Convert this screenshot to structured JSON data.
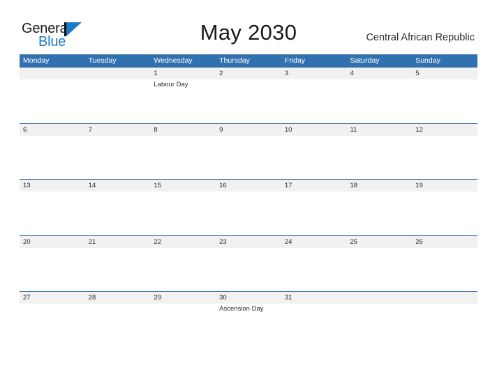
{
  "brand": {
    "logo_primary": "General",
    "logo_secondary": "Blue",
    "logo_mark": "blue-triangle-flag-icon",
    "primary_color": "#1b79c8"
  },
  "header": {
    "title": "May 2030",
    "country": "Central African Republic"
  },
  "theme": {
    "header_blue": "#3271b0",
    "band_gray": "#f1f1f1",
    "row_border": "#2f6ca8",
    "text_dark": "#262626"
  },
  "calendar": {
    "month": "May",
    "year": "2030",
    "week_start": "Monday",
    "weekdays": [
      "Monday",
      "Tuesday",
      "Wednesday",
      "Thursday",
      "Friday",
      "Saturday",
      "Sunday"
    ],
    "weeks": [
      {
        "days": [
          {
            "date": "",
            "events": []
          },
          {
            "date": "",
            "events": []
          },
          {
            "date": "1",
            "events": [
              "Labour Day"
            ]
          },
          {
            "date": "2",
            "events": []
          },
          {
            "date": "3",
            "events": []
          },
          {
            "date": "4",
            "events": []
          },
          {
            "date": "5",
            "events": []
          }
        ]
      },
      {
        "days": [
          {
            "date": "6",
            "events": []
          },
          {
            "date": "7",
            "events": []
          },
          {
            "date": "8",
            "events": []
          },
          {
            "date": "9",
            "events": []
          },
          {
            "date": "10",
            "events": []
          },
          {
            "date": "11",
            "events": []
          },
          {
            "date": "12",
            "events": []
          }
        ]
      },
      {
        "days": [
          {
            "date": "13",
            "events": []
          },
          {
            "date": "14",
            "events": []
          },
          {
            "date": "15",
            "events": []
          },
          {
            "date": "16",
            "events": []
          },
          {
            "date": "17",
            "events": []
          },
          {
            "date": "18",
            "events": []
          },
          {
            "date": "19",
            "events": []
          }
        ]
      },
      {
        "days": [
          {
            "date": "20",
            "events": []
          },
          {
            "date": "21",
            "events": []
          },
          {
            "date": "22",
            "events": []
          },
          {
            "date": "23",
            "events": []
          },
          {
            "date": "24",
            "events": []
          },
          {
            "date": "25",
            "events": []
          },
          {
            "date": "26",
            "events": []
          }
        ]
      },
      {
        "days": [
          {
            "date": "27",
            "events": []
          },
          {
            "date": "28",
            "events": []
          },
          {
            "date": "29",
            "events": []
          },
          {
            "date": "30",
            "events": [
              "Ascension Day"
            ]
          },
          {
            "date": "31",
            "events": []
          },
          {
            "date": "",
            "events": []
          },
          {
            "date": "",
            "events": []
          }
        ]
      }
    ]
  }
}
